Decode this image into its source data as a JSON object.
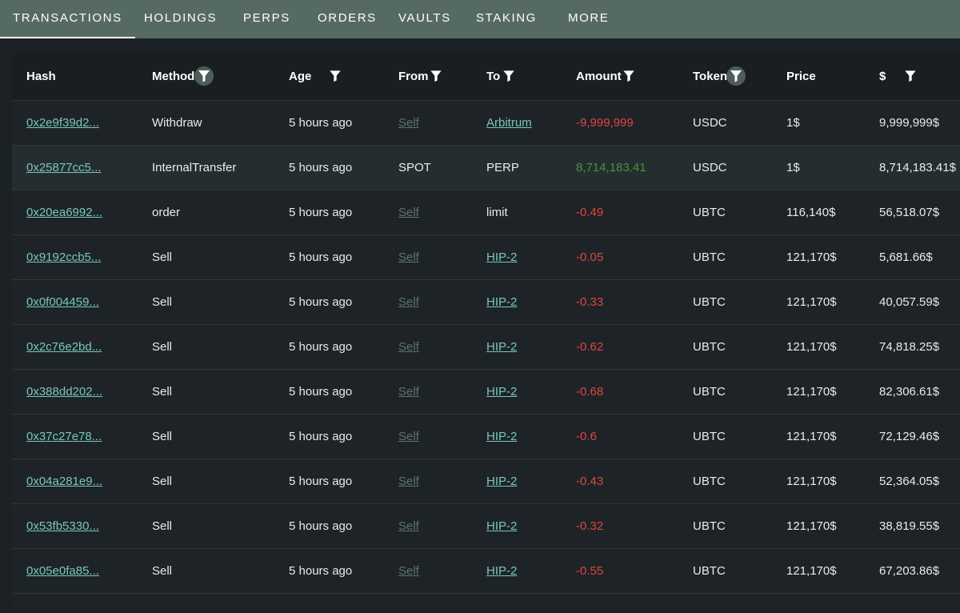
{
  "tabs": [
    {
      "label": "TRANSACTIONS",
      "active": true
    },
    {
      "label": "HOLDINGS"
    },
    {
      "label": "PERPS"
    },
    {
      "label": "ORDERS"
    },
    {
      "label": "VAULTS"
    },
    {
      "label": "STAKING"
    },
    {
      "label": "MORE"
    }
  ],
  "columns": {
    "hash": "Hash",
    "method": "Method",
    "age": "Age",
    "from": "From",
    "to": "To",
    "amount": "Amount",
    "token": "Token",
    "price": "Price",
    "usd": "$"
  },
  "colors": {
    "accent_link": "#76c8bd",
    "muted_link": "#5b756f",
    "negative": "#e0463c",
    "positive": "#3e9a33",
    "tabbar": "#566a64"
  },
  "rows": [
    {
      "hash": "0x2e9f39d2...",
      "method": "Withdraw",
      "age": "5 hours ago",
      "from": "Self",
      "to": "Arbitrum",
      "amount": "-9,999,999",
      "token": "USDC",
      "price": "1$",
      "usd": "9,999,999$"
    },
    {
      "hash": "0x25877cc5...",
      "method": "InternalTransfer",
      "age": "5 hours ago",
      "from": "SPOT",
      "to": "PERP",
      "amount": "8,714,183.41",
      "token": "USDC",
      "price": "1$",
      "usd": "8,714,183.41$"
    },
    {
      "hash": "0x20ea6992...",
      "method": "order",
      "age": "5 hours ago",
      "from": "Self",
      "to": "limit",
      "amount": "-0.49",
      "token": "UBTC",
      "price": "116,140$",
      "usd": "56,518.07$"
    },
    {
      "hash": "0x9192ccb5...",
      "method": "Sell",
      "age": "5 hours ago",
      "from": "Self",
      "to": "HIP-2",
      "amount": "-0.05",
      "token": "UBTC",
      "price": "121,170$",
      "usd": "5,681.66$"
    },
    {
      "hash": "0x0f004459...",
      "method": "Sell",
      "age": "5 hours ago",
      "from": "Self",
      "to": "HIP-2",
      "amount": "-0.33",
      "token": "UBTC",
      "price": "121,170$",
      "usd": "40,057.59$"
    },
    {
      "hash": "0x2c76e2bd...",
      "method": "Sell",
      "age": "5 hours ago",
      "from": "Self",
      "to": "HIP-2",
      "amount": "-0.62",
      "token": "UBTC",
      "price": "121,170$",
      "usd": "74,818.25$"
    },
    {
      "hash": "0x388dd202...",
      "method": "Sell",
      "age": "5 hours ago",
      "from": "Self",
      "to": "HIP-2",
      "amount": "-0.68",
      "token": "UBTC",
      "price": "121,170$",
      "usd": "82,306.61$"
    },
    {
      "hash": "0x37c27e78...",
      "method": "Sell",
      "age": "5 hours ago",
      "from": "Self",
      "to": "HIP-2",
      "amount": "-0.6",
      "token": "UBTC",
      "price": "121,170$",
      "usd": "72,129.46$"
    },
    {
      "hash": "0x04a281e9...",
      "method": "Sell",
      "age": "5 hours ago",
      "from": "Self",
      "to": "HIP-2",
      "amount": "-0.43",
      "token": "UBTC",
      "price": "121,170$",
      "usd": "52,364.05$"
    },
    {
      "hash": "0x53fb5330...",
      "method": "Sell",
      "age": "5 hours ago",
      "from": "Self",
      "to": "HIP-2",
      "amount": "-0.32",
      "token": "UBTC",
      "price": "121,170$",
      "usd": "38,819.55$"
    },
    {
      "hash": "0x05e0fa85...",
      "method": "Sell",
      "age": "5 hours ago",
      "from": "Self",
      "to": "HIP-2",
      "amount": "-0.55",
      "token": "UBTC",
      "price": "121,170$",
      "usd": "67,203.86$"
    }
  ]
}
